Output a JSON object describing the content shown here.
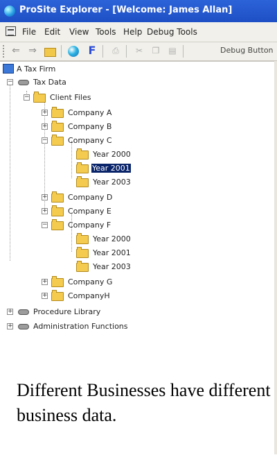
{
  "window": {
    "title": "ProSite Explorer - [Welcome: James Allan]"
  },
  "menu": {
    "items": [
      "File",
      "Edit",
      "View",
      "Tools",
      "Help",
      "Debug Tools"
    ]
  },
  "toolbar": {
    "debug_button_label": "Debug Button"
  },
  "tree": {
    "root": "A Tax Firm",
    "tax_data": "Tax Data",
    "client_files": "Client Files",
    "company_a": "Company A",
    "company_b": "Company B",
    "company_c": "Company C",
    "company_c_years": [
      "Year 2000",
      "Year 2001",
      "Year 2003"
    ],
    "company_d": "Company D",
    "company_e": "Company E",
    "company_f": "Company F",
    "company_f_years": [
      "Year 2000",
      "Year 2001",
      "Year 2003"
    ],
    "company_g": "Company G",
    "company_h": "CompanyH",
    "procedure_library": "Procedure Library",
    "admin_functions": "Administration Functions",
    "selected": "Year 2001"
  },
  "caption": "Different Businesses have different business data."
}
